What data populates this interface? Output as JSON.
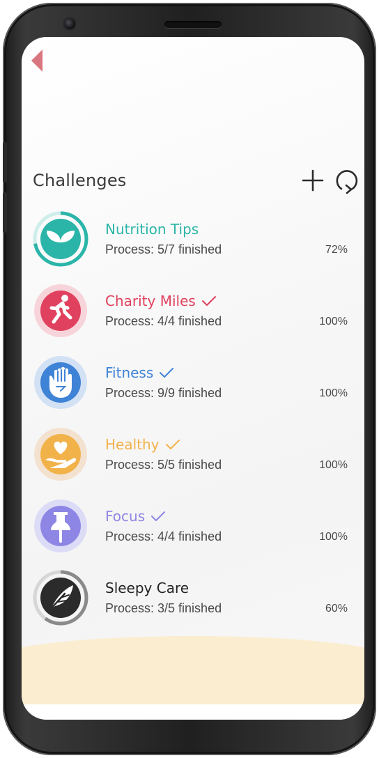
{
  "page": {
    "title": "Challenges"
  },
  "challenges": [
    {
      "name": "Nutrition Tips",
      "process": "Process: 5/7 finished",
      "percent": "72%",
      "completed": false,
      "color": "#2bb5a8",
      "progress": 0.72
    },
    {
      "name": "Charity Miles",
      "process": "Process: 4/4 finished",
      "percent": "100%",
      "completed": true,
      "color": "#e0415e",
      "progress": 1.0
    },
    {
      "name": "Fitness",
      "process": "Process: 9/9 finished",
      "percent": "100%",
      "completed": true,
      "color": "#3f83d6",
      "progress": 1.0
    },
    {
      "name": "Healthy",
      "process": "Process: 5/5 finished",
      "percent": "100%",
      "completed": true,
      "color": "#f2b24a",
      "progress": 1.0
    },
    {
      "name": "Focus",
      "process": "Process: 4/4 finished",
      "percent": "100%",
      "completed": true,
      "color": "#8e86e4",
      "progress": 1.0
    },
    {
      "name": "Sleepy Care",
      "process": "Process: 3/5 finished",
      "percent": "60%",
      "completed": false,
      "color": "#2b2b2b",
      "progress": 0.6
    }
  ],
  "icons": {
    "back": "chevron-left-icon",
    "add": "plus-icon",
    "refresh": "refresh-icon",
    "badges": [
      "sprout-icon",
      "running-person-icon",
      "raised-fist-icon",
      "heart-hand-icon",
      "pushpin-icon",
      "feather-icon"
    ]
  },
  "colors": {
    "back": "#d9767f",
    "title": "#3b3b3b",
    "bottom_wave": "#fbedd0"
  }
}
